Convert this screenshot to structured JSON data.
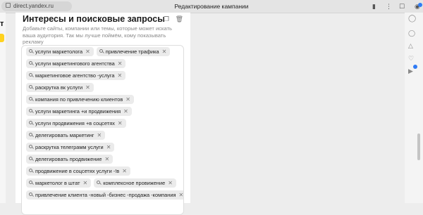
{
  "browser": {
    "url": "direct.yandex.ru",
    "tab_title": "Редактирование кампании"
  },
  "section": {
    "title": "Интересы и поисковые запросы",
    "description": "Добавьте сайты, компании или темы, которые может искать ваша аудитория. Так мы лучше поймём, кому показывать рекламу"
  },
  "left_letter": "т",
  "rows": [
    [
      "услуги маркетолога",
      "привлечение трафика"
    ],
    [
      "услуги маркетингового агентства"
    ],
    [
      "маркетинговое агентство -услуга"
    ],
    [
      "раскрутка вк услуги"
    ],
    [
      "компания по привлечению клиентов"
    ],
    [
      "услуги маркетинга +и продвижения"
    ],
    [
      "услуги продвижения +в соцсетях"
    ],
    [
      "делегировать маркетинг"
    ],
    [
      "раскрутка телеграмм услуги"
    ],
    [
      "делегировать продвижение"
    ],
    [
      "продвижение в соцсетях услуги -!в"
    ],
    [
      "маркетолог в штат",
      "комплексное провижение"
    ],
    [
      "привлечение клиента -новый -бизнес -продажа -компания"
    ]
  ],
  "icons": {
    "copy": "copy-icon",
    "delete": "trash-icon",
    "search_chip": "search-icon",
    "remove_chip": "close-icon"
  }
}
